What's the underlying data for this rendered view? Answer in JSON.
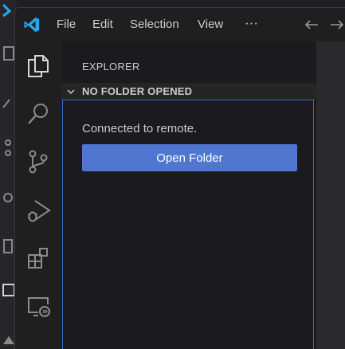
{
  "titlebar": {
    "menu": [
      "File",
      "Edit",
      "Selection",
      "View",
      "···"
    ]
  },
  "sidebar": {
    "title": "EXPLORER",
    "section_title": "NO FOLDER OPENED",
    "message": "Connected to remote.",
    "open_folder_label": "Open Folder"
  },
  "colors": {
    "accent_button": "#4f77cf",
    "focus_border": "#3b6dc6",
    "vscode_blue": "#23a9f2"
  },
  "icons": {
    "activity_bar": [
      "files-icon",
      "search-icon",
      "source-control-icon",
      "run-debug-icon",
      "extensions-icon",
      "remote-explorer-icon"
    ]
  }
}
